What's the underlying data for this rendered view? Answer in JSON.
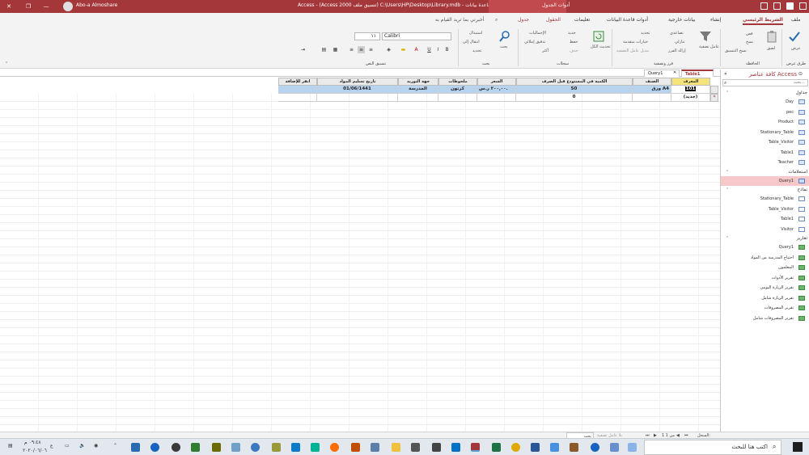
{
  "titlebar": {
    "user": "Abo-a Almoshare",
    "title": "Access  -  (Access 2000 تنسيق ملف) C:\\Users\\HP\\Desktop\\Library.mdb - قاعدة بيانات : Library",
    "context_tab": "أدوات الجدول"
  },
  "ribbon_tabs": {
    "file": "ملف",
    "home": "الشريط الرئيسي",
    "create": "إنشاء",
    "external": "بيانات خارجية",
    "db_tools": "أدوات قاعدة البيانات",
    "help": "تعليمات",
    "fields": "الحقول",
    "table": "جدول",
    "tell_me": "أخبرني بما تريد القيام به"
  },
  "ribbon": {
    "view": "عرض",
    "views_group": "طرق عرض",
    "cut": "قص",
    "copy": "نسخ",
    "paste": "لصق",
    "format_painter": "نسخ التنسيق",
    "clipboard_group": "الحافظة",
    "filter": "عامل تصفية",
    "ascending": "تصاعدي",
    "descending": "تنازلي",
    "remove_sort": "إزالة الفرز",
    "selection": "تحديد",
    "advanced": "خيارات متقدمة",
    "toggle_filter": "تبديل عامل التصفية",
    "sort_filter_group": "فرز وتصفية",
    "refresh_all": "تحديث الكل",
    "new": "جديد",
    "save": "حفظ",
    "delete": "حذف",
    "totals": "الإجماليات",
    "spelling": "تدقيق إملائي",
    "more": "أكثر",
    "records_group": "سجلات",
    "find": "بحث",
    "replace": "استبدال",
    "goto": "انتقال إلى",
    "select": "تحديد",
    "find_group": "بحث",
    "font_name": "Calibri",
    "font_size": "١١",
    "text_format_group": "تنسيق النص"
  },
  "nav": {
    "title": "كافة عناصر Access",
    "search_placeholder": "بحث...",
    "categories": [
      {
        "label": "جداول",
        "items": [
          "Day",
          "pec",
          "Product",
          "Stationary_Table",
          "Table_Visitor",
          "Table1",
          "Teacher"
        ]
      },
      {
        "label": "استعلامات",
        "items": [
          "Query1"
        ]
      },
      {
        "label": "نماذج",
        "items": [
          "Stationary_Table",
          "Table_Visitor",
          "Table1",
          "Visitor"
        ]
      },
      {
        "label": "تقارير",
        "items": [
          "Query1",
          "احتياج المدرسة من المواد",
          "المعلمون",
          "تقرير الأدوات",
          "تقرير الزيارة اليومي",
          "تقرير الزيارة شامل",
          "تقرير المصروفات",
          "تقرير المصروفات شامل"
        ]
      }
    ]
  },
  "doc_tabs": {
    "table1": "Table1",
    "query1": "Query1"
  },
  "datasheet": {
    "columns": [
      "المعرف",
      "الصنف",
      "الكمية في المستودع قبل الصرف",
      "السعر",
      "ملحوظات",
      "جهة التوريد",
      "تاريخ تسليم المواد",
      "انقر للإضافة"
    ],
    "row1": [
      "101",
      "ورق A4",
      "50",
      "٢٠٠,٠٠ ر.س.",
      "كرتون",
      "المدرسة",
      "01/06/1441",
      ""
    ],
    "new_row": [
      "(جديد)",
      "",
      "0",
      "",
      "",
      "",
      "",
      ""
    ]
  },
  "statusbar": {
    "record_label": "السجل:",
    "record_pos": "1 من 1",
    "no_filter": "بلا عامل تصفية",
    "search": "بحث"
  },
  "taskbar": {
    "search_placeholder": "اكتب هنا للبحث",
    "time": "٠٩:٤٨ م",
    "date": "٢٠٢٠/٠٦/٠٦",
    "lang": "ع"
  },
  "colors": {
    "accent": "#a4373a",
    "row_highlight": "#b7d3ee",
    "selected_nav": "#f6c8c9"
  }
}
